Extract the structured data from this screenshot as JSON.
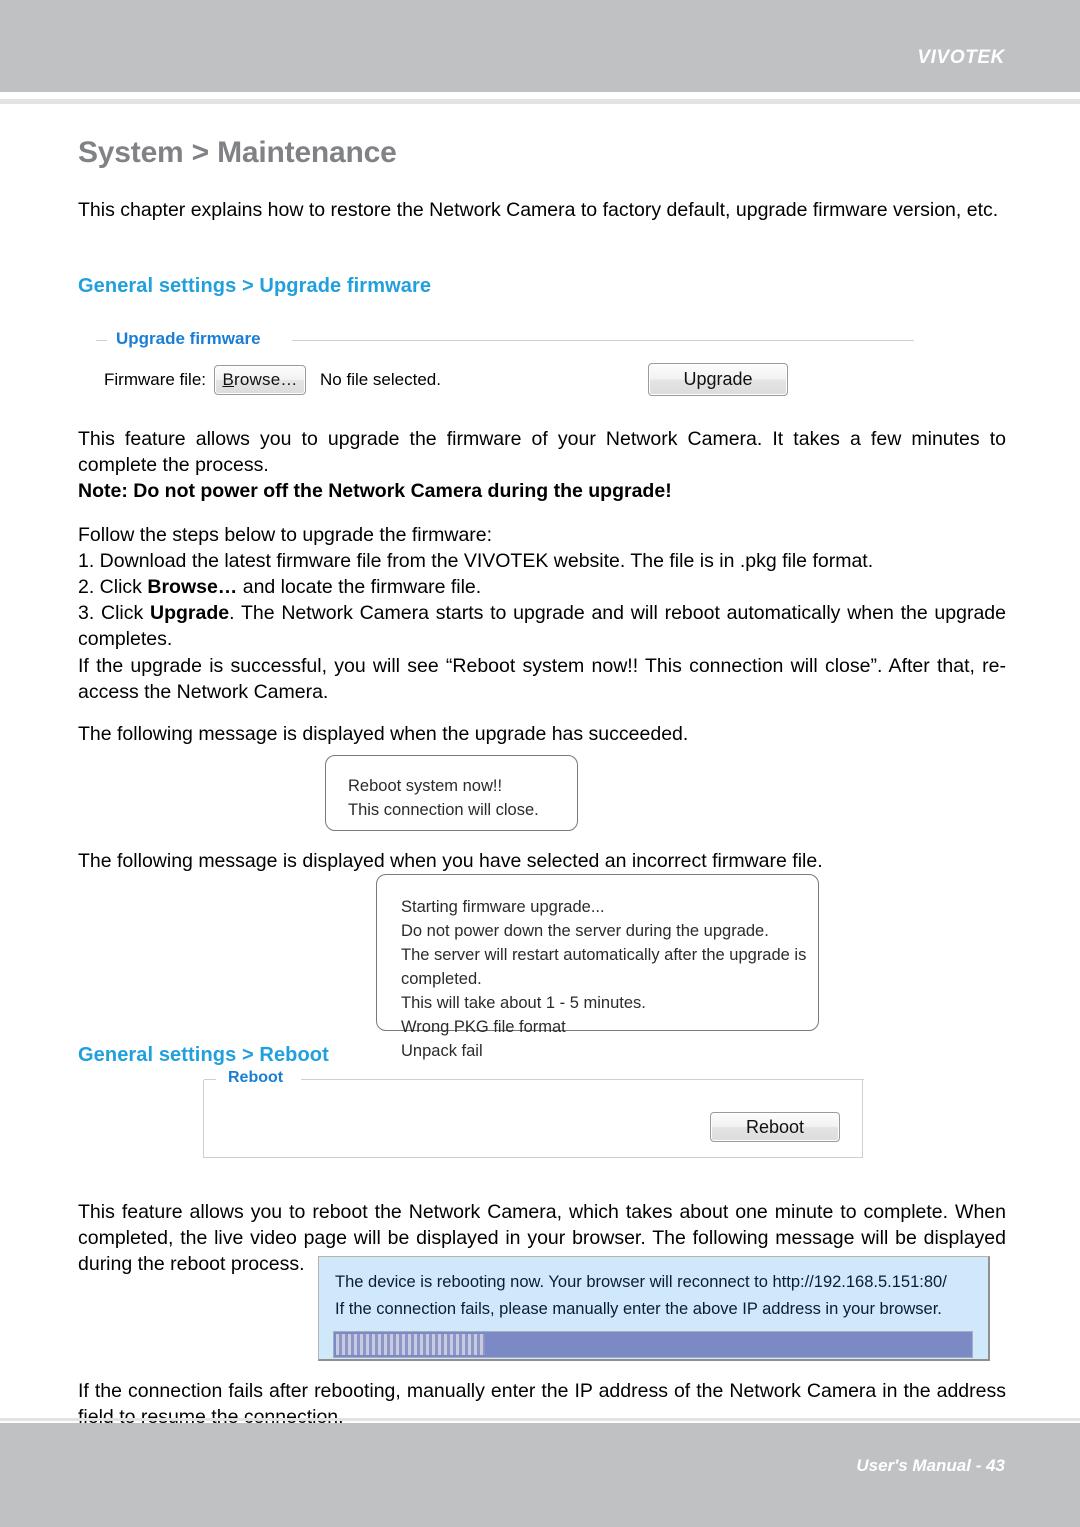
{
  "header": {
    "brand": "VIVOTEK"
  },
  "footer": {
    "text": "User's Manual - 43"
  },
  "page": {
    "title": "System > Maintenance",
    "intro": "This chapter explains how to restore the Network Camera to factory default, upgrade firmware version, etc."
  },
  "upgrade_section": {
    "heading": "General settings > Upgrade firmware",
    "panel": {
      "legend": "Upgrade firmware",
      "field_label": "Firmware file:",
      "browse_button": "Browse…",
      "browse_accel": "B",
      "browse_rest": "rowse…",
      "file_status": "No file selected.",
      "upgrade_button": "Upgrade"
    },
    "description": "This feature allows you to upgrade the firmware of your Network Camera. It takes a few minutes to complete the process.",
    "note": "Note: Do not power off the Network Camera during the upgrade!",
    "steps_intro": "Follow the steps below to upgrade the firmware:",
    "steps": [
      "1. Download the latest firmware file from the VIVOTEK website. The file is in .pkg file format.",
      "2. Click Browse… and locate the firmware file.",
      "3. Click Upgrade. The Network Camera starts to upgrade and will reboot automatically when the upgrade completes."
    ],
    "step2_prefix": "2. Click ",
    "step2_bold": "Browse…",
    "step2_suffix": " and locate the firmware file.",
    "step3_prefix": "3. Click ",
    "step3_bold": "Upgrade",
    "step3_suffix": ". The Network Camera starts to upgrade and will reboot automatically when the upgrade completes.",
    "success_note": "If the upgrade is successful, you will see “Reboot system now!! This connection will close”. After that, re-access the Network Camera.",
    "success_caption": "The following message is displayed when the upgrade has succeeded.",
    "success_message": [
      "Reboot system now!!",
      "This connection will close."
    ],
    "error_caption": "The following message is displayed when you have selected an incorrect firmware file.",
    "error_message": [
      "Starting firmware upgrade...",
      "Do not power down the server during the upgrade.",
      "The server will restart automatically after the upgrade is",
      "completed.",
      "This will take about 1 - 5 minutes.",
      "Wrong PKG file format",
      "Unpack fail"
    ]
  },
  "reboot_section": {
    "heading": "General settings > Reboot",
    "panel": {
      "legend": "Reboot",
      "reboot_button": "Reboot"
    },
    "description": "This feature allows you to reboot the Network Camera, which takes about one minute to complete. When completed, the live video page will be displayed in your browser. The following message will be displayed during the reboot process.",
    "dialog": {
      "line1": "The device is rebooting now. Your browser will reconnect to http://192.168.5.151:80/",
      "line2": "If the connection fails, please manually enter the above IP address in your browser.",
      "progress_percent": 24
    },
    "closing": "If the connection fails after rebooting, manually enter the IP address of the Network Camera in the address field to resume the connection."
  },
  "colors": {
    "heading_blue": "#21a0dd",
    "legend_blue": "#1a7fd4",
    "title_gray": "#808285",
    "band_gray": "#bfc1c2",
    "dialog_blue": "#cfe9fb",
    "progress_bar": "#7b89c4"
  }
}
